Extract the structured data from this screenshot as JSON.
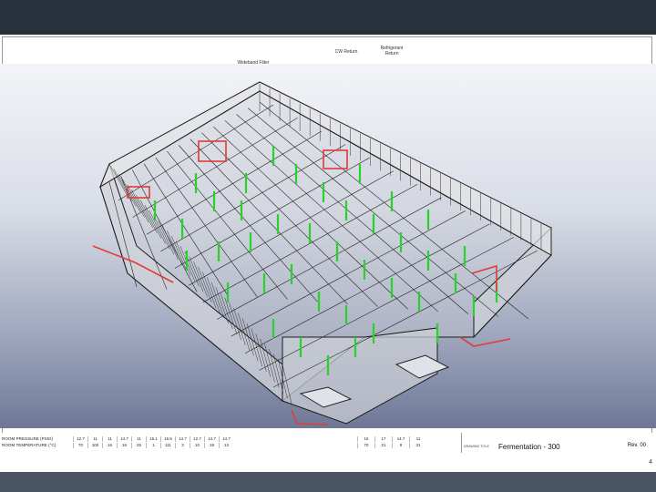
{
  "drawing": {
    "header_labels": {
      "cw_return": "CW Return",
      "refrigerant_return": "Refrigerant\nReturn",
      "wideband_filter": "Wideband Filter"
    },
    "schedule_rows": [
      {
        "label": "ROOM PRESSURE (PSIG)",
        "values": [
          "12.7",
          "11",
          "11",
          "14.7",
          "11",
          "16.1",
          "16.5",
          "14.7",
          "12.7",
          "14.7",
          "14.7"
        ],
        "values_right": [
          "16",
          "17",
          "14.7",
          "11"
        ]
      },
      {
        "label": "ROOM TEMPERATURE (°C)",
        "values": [
          "70",
          "100",
          "16",
          "16",
          "25",
          "1",
          "111",
          "3",
          "10",
          "18",
          "13"
        ],
        "values_right": [
          "70",
          "21",
          "8",
          "31"
        ]
      }
    ],
    "title_block": {
      "drawing_label": "DRAWING TITLE",
      "drawing_title": "Fermentation - 300",
      "rev": "Rev. 00"
    },
    "page_number": "4"
  },
  "colors": {
    "bezel": "#27303b",
    "structure_line": "#1b1b1b",
    "pipe_vertical": "#27d32a",
    "highlight": "#e23a3a"
  }
}
